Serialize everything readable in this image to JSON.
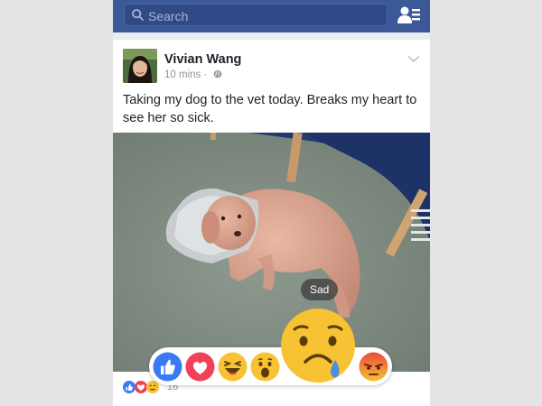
{
  "search": {
    "placeholder": "Search",
    "icon": "search-icon"
  },
  "topbar": {
    "friends_icon": "friend-requests-icon",
    "color": "#3b5998"
  },
  "post": {
    "author": "Vivian Wang",
    "time": "10 mins",
    "privacy": "·",
    "text": "Taking my dog to the vet today. Breaks my heart to see her so sick.",
    "reaction_count": "16"
  },
  "reaction_tray": {
    "tooltip": "Sad",
    "items": [
      "like",
      "love",
      "haha",
      "wow",
      "sad",
      "angry"
    ]
  },
  "colors": {
    "like": "#3b7af5",
    "love": "#f0405a",
    "emoji": "#f7c233",
    "angry": "#e94a3a"
  }
}
